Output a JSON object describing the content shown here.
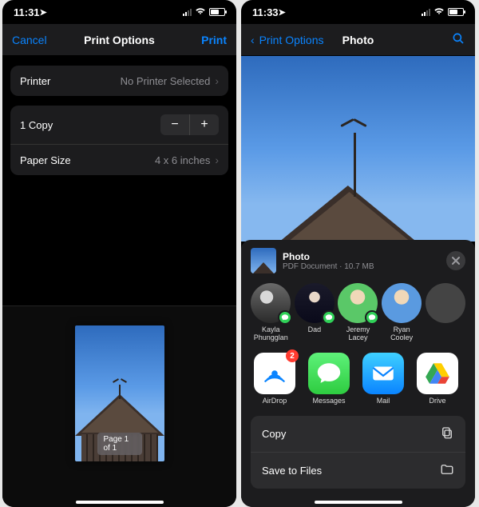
{
  "left": {
    "status": {
      "time": "11:31"
    },
    "nav": {
      "cancel": "Cancel",
      "title": "Print Options",
      "print": "Print"
    },
    "printer": {
      "label": "Printer",
      "value": "No Printer Selected"
    },
    "copies": {
      "label": "1 Copy"
    },
    "paper": {
      "label": "Paper Size",
      "value": "4 x 6 inches"
    },
    "page_badge": "Page 1 of 1"
  },
  "right": {
    "status": {
      "time": "11:33"
    },
    "nav": {
      "back": "Print Options",
      "title": "Photo"
    },
    "sheet": {
      "title": "Photo",
      "subtitle": "PDF Document · 10.7 MB",
      "contacts": [
        {
          "name": "Kayla Phungglan",
          "cls": "k",
          "msg": true
        },
        {
          "name": "Dad",
          "cls": "d",
          "msg": true
        },
        {
          "name": "Jeremy Lacey",
          "cls": "j",
          "msg": true
        },
        {
          "name": "Ryan Cooley",
          "cls": "r",
          "msg": false
        },
        {
          "name": "",
          "cls": "x",
          "msg": false
        }
      ],
      "apps": [
        {
          "name": "AirDrop",
          "kind": "airdrop",
          "badge": "2"
        },
        {
          "name": "Messages",
          "kind": "messages"
        },
        {
          "name": "Mail",
          "kind": "mail"
        },
        {
          "name": "Drive",
          "kind": "drive"
        }
      ],
      "actions": {
        "copy": "Copy",
        "save": "Save to Files"
      }
    }
  }
}
